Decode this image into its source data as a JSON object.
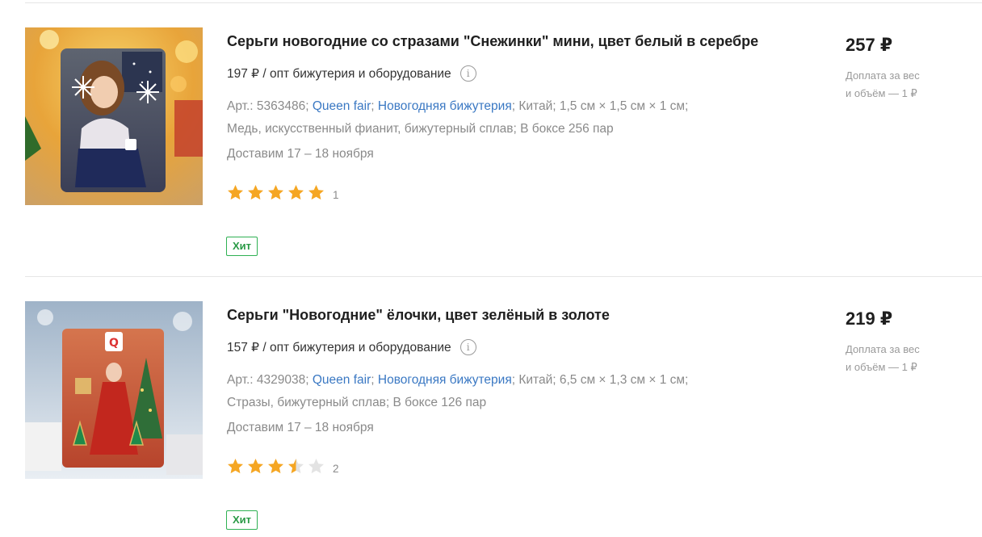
{
  "products": [
    {
      "title": "Серьги новогодние со стразами \"Снежинки\" мини, цвет белый в серебре",
      "wholesale": "197 ₽ / опт бижутерия и оборудование",
      "art_prefix": "Арт.: 5363486; ",
      "brand": "Queen fair",
      "category": "Новогодняя бижутерия",
      "specs_line1_rest": "; Китай; 1,5 см × 1,5 см × 1 см;",
      "specs_line2": "Медь, искусственный фианит, бижутерный сплав; В боксе 256 пар",
      "delivery": "Доставим 17 – 18 ноября",
      "rating": 5,
      "rating_count": "1",
      "badge": "Хит",
      "price": "257 ₽",
      "surcharge_line1": "Доплата за вес",
      "surcharge_line2": "и объём — 1 ₽",
      "image": "product-photo-snowflake-earrings"
    },
    {
      "title": "Серьги \"Новогодние\" ёлочки, цвет зелёный в золоте",
      "wholesale": "157 ₽ / опт бижутерия и оборудование",
      "art_prefix": "Арт.: 4329038; ",
      "brand": "Queen fair",
      "category": "Новогодняя бижутерия",
      "specs_line1_rest": "; Китай; 6,5 см × 1,3 см × 1 см;",
      "specs_line2": "Стразы, бижутерный сплав; В боксе 126 пар",
      "delivery": "Доставим 17 – 18 ноября",
      "rating": 3.5,
      "rating_count": "2",
      "badge": "Хит",
      "price": "219 ₽",
      "surcharge_line1": "Доплата за вес",
      "surcharge_line2": "и объём — 1 ₽",
      "image": "product-photo-christmas-tree-earrings"
    }
  ],
  "colors": {
    "star_filled": "#f5a623",
    "star_empty": "#e3e3e3",
    "link": "#3a78c3",
    "badge_green": "#2fb153"
  }
}
